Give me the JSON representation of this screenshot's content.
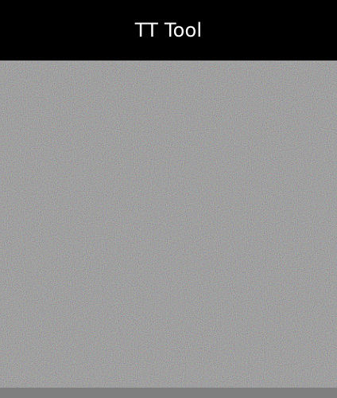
{
  "app": {
    "title": "TT Tool"
  },
  "colors": {
    "title_bar_bg": "#000000",
    "title_text": "#ffffff",
    "noise_base": "#808080",
    "bottom_strip": "#7f7f7f"
  }
}
